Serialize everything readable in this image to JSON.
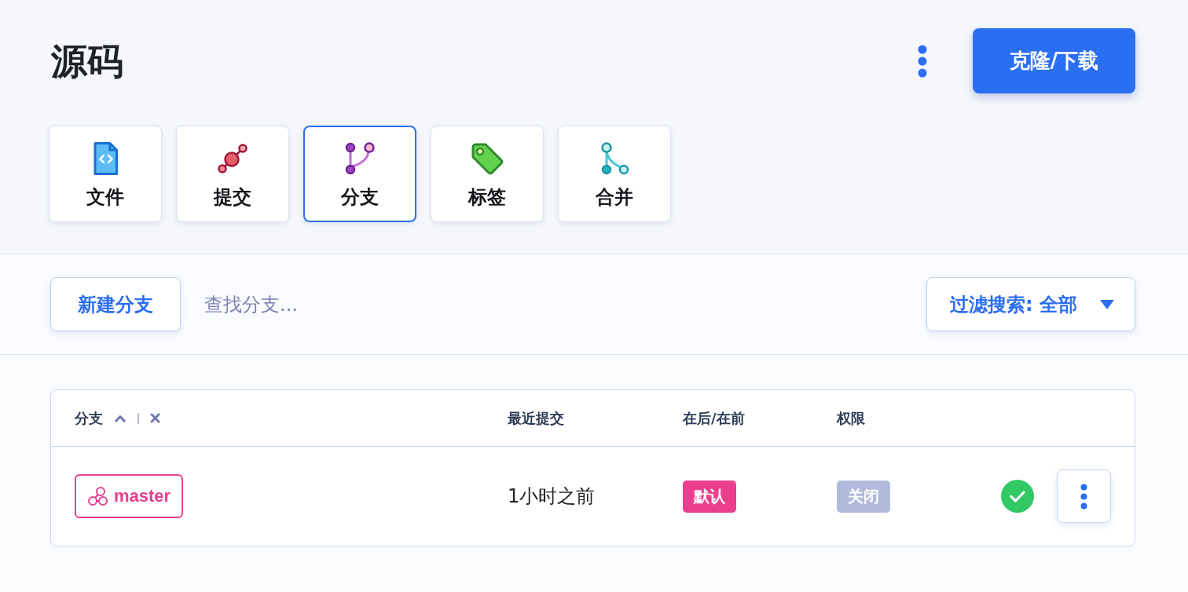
{
  "header": {
    "title": "源码",
    "clone_button": "克隆/下载"
  },
  "tabs": [
    {
      "label": "文件",
      "kind": "file",
      "selected": false
    },
    {
      "label": "提交",
      "kind": "commit",
      "selected": false
    },
    {
      "label": "分支",
      "kind": "branch",
      "selected": true
    },
    {
      "label": "标签",
      "kind": "tag",
      "selected": false
    },
    {
      "label": "合并",
      "kind": "merge",
      "selected": false
    }
  ],
  "toolbar": {
    "new_button": "新建分支",
    "search": {
      "placeholder": "查找分支..."
    },
    "filter": "过滤搜索: 全部"
  },
  "table": {
    "columns": [
      {
        "label": "分支",
        "sorted": true,
        "clearable": true
      },
      {
        "label": "最近提交",
        "sorted": false,
        "clearable": false
      },
      {
        "label": "在后/在前",
        "sorted": false,
        "clearable": false
      },
      {
        "label": "权限",
        "sorted": false,
        "clearable": false
      }
    ],
    "rows": [
      {
        "branch": "master",
        "last_commit": "1小时之前",
        "behind_ahead": {
          "label": "默认",
          "kind": "default"
        },
        "permission": {
          "label": "关闭",
          "kind": "closed"
        },
        "checked": true
      }
    ]
  }
}
